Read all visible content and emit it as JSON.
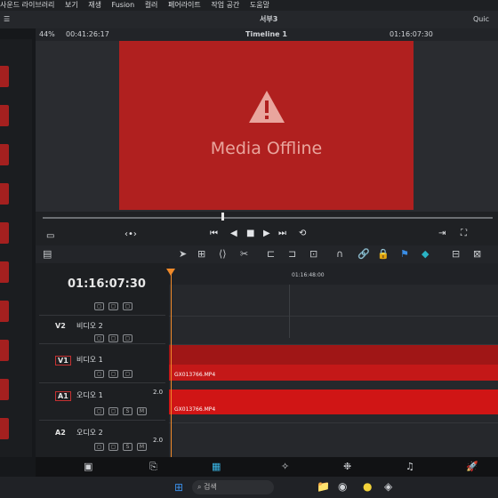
{
  "menu": {
    "items": [
      "사운드 라이브러리",
      "보기",
      "재생",
      "Fusion",
      "컬러",
      "페어라이트",
      "작업 공간",
      "도움말"
    ]
  },
  "project": {
    "title": "서부3",
    "quick_label": "Quic"
  },
  "viewer": {
    "zoom": "44%",
    "timecode_left": "00:41:26:17",
    "timeline_name": "Timeline 1",
    "timecode_right": "01:16:07:30",
    "offline_message": "Media Offline"
  },
  "timeline": {
    "current_timecode": "01:16:07:30",
    "ruler_mark": "01:16:48:00",
    "tracks": [
      {
        "id": "V2",
        "name": "비디오 2",
        "selected": false
      },
      {
        "id": "V1",
        "name": "비디오 1",
        "selected": true
      },
      {
        "id": "A1",
        "name": "오디오 1",
        "selected": true,
        "channels": "2.0"
      },
      {
        "id": "A2",
        "name": "오디오 2",
        "selected": false,
        "channels": "2.0"
      }
    ],
    "video_clip": "GX013766.MP4",
    "audio_clip": "GX013766.MP4"
  },
  "taskbar": {
    "search_placeholder": "검색"
  },
  "colors": {
    "offline_red": "#b0201f",
    "clip_red": "#c41818",
    "playhead": "#f08a2a"
  }
}
